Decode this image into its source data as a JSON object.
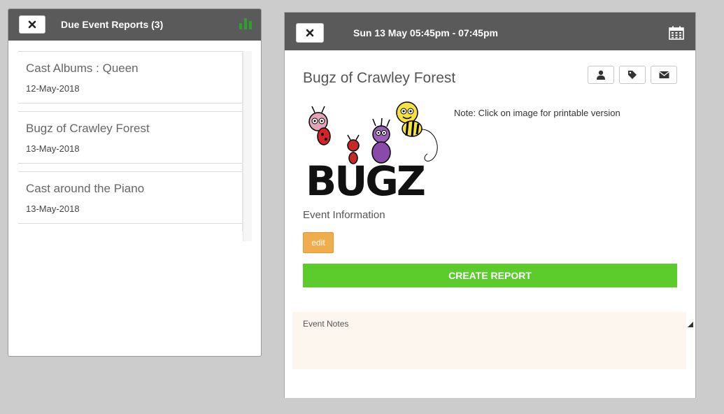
{
  "left_panel": {
    "title": "Due Event Reports (3)",
    "close_icon": "close-icon",
    "chart_icon": "bar-chart-icon",
    "reports": [
      {
        "title": "Cast Albums : Queen",
        "date": "12-May-2018"
      },
      {
        "title": "Bugz of Crawley Forest",
        "date": "13-May-2018"
      },
      {
        "title": "Cast around the Piano",
        "date": "13-May-2018"
      }
    ]
  },
  "event_panel": {
    "header": "Sun 13 May 05:45pm - 07:45pm",
    "calendar_icon": "calendar-icon",
    "title": "Bugz of Crawley Forest",
    "action_icons": [
      "user-icon",
      "tag-icon",
      "envelope-icon"
    ],
    "image_caption": "BUGZ",
    "note": "Note: Click on image for printable version",
    "section_label": "Event Information",
    "edit_label": "edit",
    "create_report_label": "CREATE REPORT",
    "notes_placeholder": "Event Notes"
  },
  "colors": {
    "header_bg": "#5a5a5a",
    "create_button": "#5ccc2c",
    "edit_button": "#f0ad4e",
    "notes_bg": "#fdf6ef",
    "chart_icon": "#2e9e2e"
  }
}
